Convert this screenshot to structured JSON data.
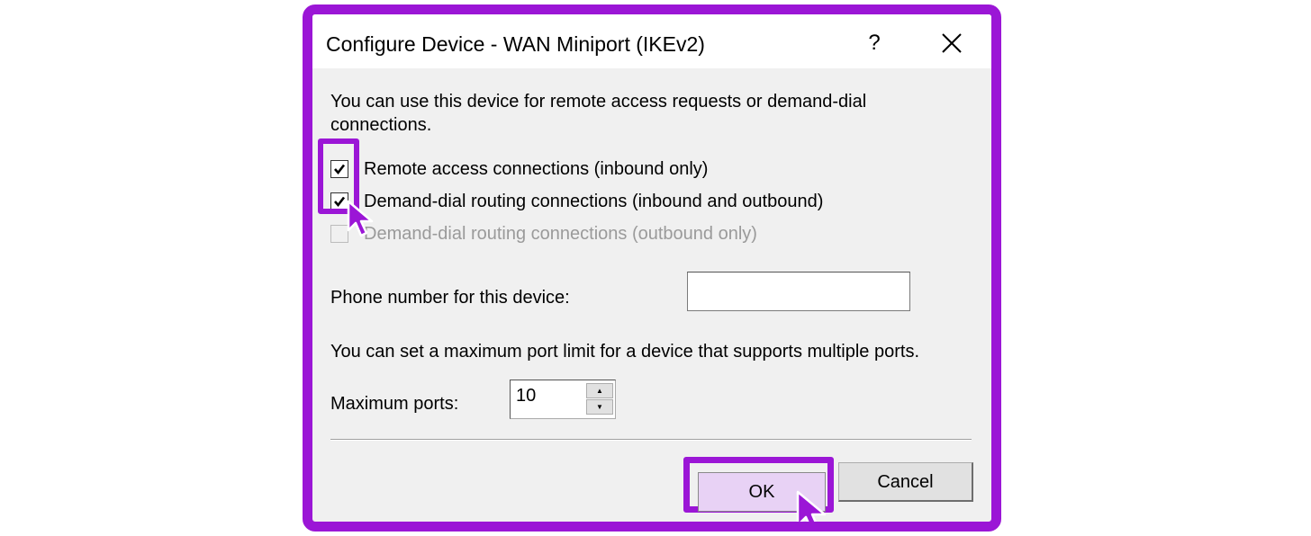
{
  "dialog": {
    "title": "Configure Device - WAN Miniport (IKEv2)",
    "help_label": "?",
    "close_label": "close",
    "description": "You can use this device for remote access requests or demand-dial connections."
  },
  "checkboxes": [
    {
      "label": "Remote access connections (inbound only)",
      "checked": true,
      "enabled": true
    },
    {
      "label": "Demand-dial routing connections (inbound and outbound)",
      "checked": true,
      "enabled": true
    },
    {
      "label": "Demand-dial routing connections (outbound only)",
      "checked": false,
      "enabled": false
    }
  ],
  "phone": {
    "label": "Phone number for this device:",
    "value": ""
  },
  "ports": {
    "description": "You can set a maximum port limit for a device that supports multiple ports.",
    "label": "Maximum ports:",
    "value": "10"
  },
  "buttons": {
    "ok_label": "OK",
    "cancel_label": "Cancel"
  },
  "colors": {
    "highlight": "#9b16d6",
    "ok_fill": "#e8d2f5",
    "dialog_bg": "#f0f0f0"
  }
}
